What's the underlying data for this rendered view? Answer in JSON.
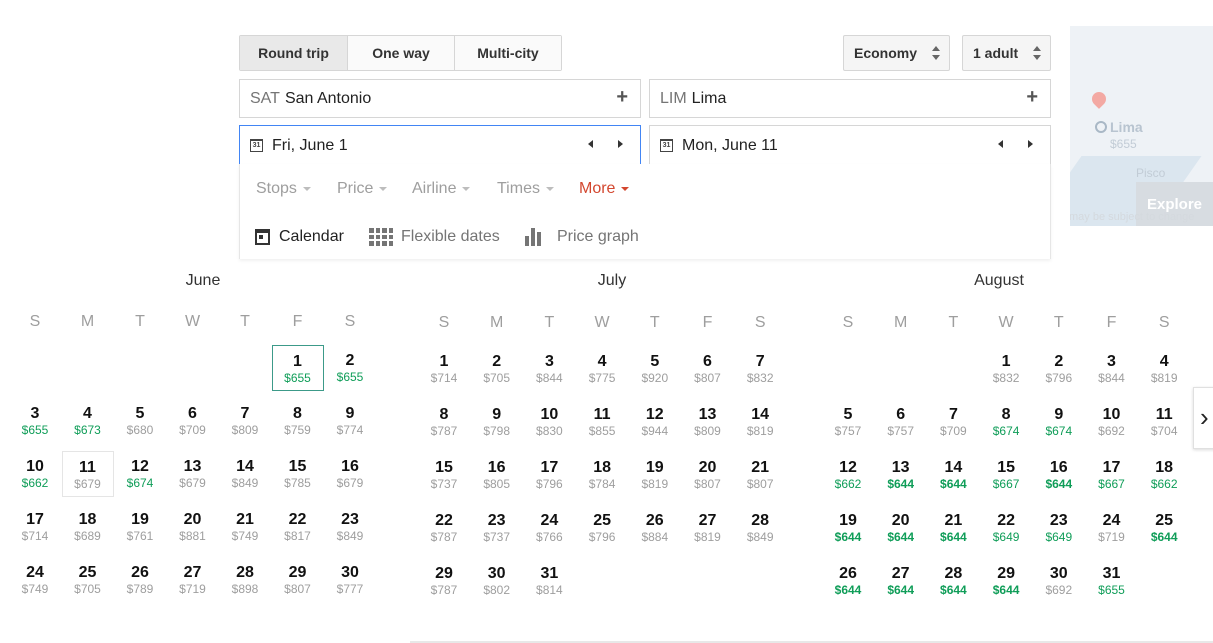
{
  "trip_types": {
    "round": "Round trip",
    "oneway": "One way",
    "multi": "Multi-city"
  },
  "cabin": "Economy",
  "passengers": "1 adult",
  "origin": {
    "code": "SAT",
    "city": "San Antonio"
  },
  "destination": {
    "code": "LIM",
    "city": "Lima"
  },
  "depart_date": "Fri, June 1",
  "return_date": "Mon, June 11",
  "calicon_text": "31",
  "filters": {
    "stops": "Stops",
    "price": "Price",
    "airline": "Airline",
    "times": "Times",
    "more": "More"
  },
  "views": {
    "calendar": "Calendar",
    "flexible": "Flexible dates",
    "graph": "Price graph"
  },
  "map": {
    "city": "Lima",
    "price": "$655",
    "place": "Pisco",
    "explore": "Explore",
    "disclaimer": "may be subject to change"
  },
  "weekdays": [
    "S",
    "M",
    "T",
    "W",
    "T",
    "F",
    "S"
  ],
  "months": [
    {
      "name": "June",
      "start": 5,
      "days": [
        [
          "$655",
          "low"
        ],
        [
          "$655",
          "low"
        ],
        [
          "$655",
          "low"
        ],
        [
          "$673",
          "low"
        ],
        [
          "$680",
          ""
        ],
        [
          "$709",
          ""
        ],
        [
          "$809",
          ""
        ],
        [
          "$759",
          ""
        ],
        [
          "$774",
          ""
        ],
        [
          "$662",
          "low"
        ],
        [
          "$679",
          ""
        ],
        [
          "$674",
          "low"
        ],
        [
          "$679",
          ""
        ],
        [
          "$849",
          ""
        ],
        [
          "$785",
          ""
        ],
        [
          "$679",
          ""
        ],
        [
          "$714",
          ""
        ],
        [
          "$689",
          ""
        ],
        [
          "$761",
          ""
        ],
        [
          "$881",
          ""
        ],
        [
          "$749",
          ""
        ],
        [
          "$817",
          ""
        ],
        [
          "$849",
          ""
        ],
        [
          "$749",
          ""
        ],
        [
          "$705",
          ""
        ],
        [
          "$789",
          ""
        ],
        [
          "$719",
          ""
        ],
        [
          "$898",
          ""
        ],
        [
          "$807",
          ""
        ],
        [
          "$777",
          ""
        ]
      ]
    },
    {
      "name": "July",
      "start": 0,
      "days": [
        [
          "$714",
          ""
        ],
        [
          "$705",
          ""
        ],
        [
          "$844",
          ""
        ],
        [
          "$775",
          ""
        ],
        [
          "$920",
          ""
        ],
        [
          "$807",
          ""
        ],
        [
          "$832",
          ""
        ],
        [
          "$787",
          ""
        ],
        [
          "$798",
          ""
        ],
        [
          "$830",
          ""
        ],
        [
          "$855",
          ""
        ],
        [
          "$944",
          ""
        ],
        [
          "$809",
          ""
        ],
        [
          "$819",
          ""
        ],
        [
          "$737",
          ""
        ],
        [
          "$805",
          ""
        ],
        [
          "$796",
          ""
        ],
        [
          "$784",
          ""
        ],
        [
          "$819",
          ""
        ],
        [
          "$807",
          ""
        ],
        [
          "$807",
          ""
        ],
        [
          "$787",
          ""
        ],
        [
          "$737",
          ""
        ],
        [
          "$766",
          ""
        ],
        [
          "$796",
          ""
        ],
        [
          "$884",
          ""
        ],
        [
          "$819",
          ""
        ],
        [
          "$849",
          ""
        ],
        [
          "$787",
          ""
        ],
        [
          "$802",
          ""
        ],
        [
          "$814",
          ""
        ]
      ]
    },
    {
      "name": "August",
      "start": 3,
      "days": [
        [
          "$832",
          ""
        ],
        [
          "$796",
          ""
        ],
        [
          "$844",
          ""
        ],
        [
          "$819",
          ""
        ],
        [
          "$757",
          ""
        ],
        [
          "$757",
          ""
        ],
        [
          "$709",
          ""
        ],
        [
          "$674",
          "low"
        ],
        [
          "$674",
          "low"
        ],
        [
          "$692",
          ""
        ],
        [
          "$704",
          ""
        ],
        [
          "$662",
          "low"
        ],
        [
          "$644",
          "best"
        ],
        [
          "$644",
          "best"
        ],
        [
          "$667",
          "low"
        ],
        [
          "$644",
          "best"
        ],
        [
          "$667",
          "low"
        ],
        [
          "$662",
          "low"
        ],
        [
          "$644",
          "best"
        ],
        [
          "$644",
          "best"
        ],
        [
          "$644",
          "best"
        ],
        [
          "$649",
          "low"
        ],
        [
          "$649",
          "low"
        ],
        [
          "$719",
          ""
        ],
        [
          "$644",
          "best"
        ],
        [
          "$644",
          "best"
        ],
        [
          "$644",
          "best"
        ],
        [
          "$644",
          "best"
        ],
        [
          "$644",
          "best"
        ],
        [
          "$692",
          ""
        ],
        [
          "$655",
          "low"
        ]
      ]
    }
  ],
  "selected": {
    "depart": [
      0,
      1
    ],
    "return": [
      0,
      11
    ]
  },
  "next_glyph": "›"
}
